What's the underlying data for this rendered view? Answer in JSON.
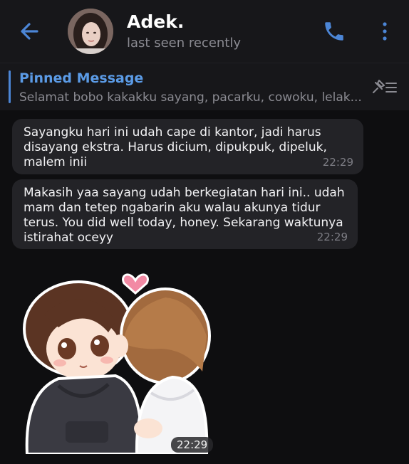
{
  "header": {
    "title": "Adek.",
    "status": "last seen recently",
    "back_icon": "arrow-left-icon",
    "call_icon": "phone-icon",
    "menu_icon": "more-vertical-icon",
    "accent": "#4c86d6"
  },
  "pinned": {
    "label": "Pinned Message",
    "text": "Selamat bobo kakakku sayang, pacarku, cowoku, lelak...",
    "unpin_icon": "unpin-icon"
  },
  "messages": [
    {
      "text": "Sayangku hari ini udah cape di kantor, jadi harus disayang ekstra. Harus dicium, dipukpuk, dipeluk, malem inii",
      "time": "22:29"
    },
    {
      "text": "Makasih yaa sayang udah berkegiatan hari ini.. udah mam dan tetep ngabarin aku walau akunya tidur terus. You did well today, honey. Sekarang waktunya istirahat oceyy",
      "time": "22:29"
    }
  ],
  "sticker": {
    "icon": "hug-sticker",
    "time": "22:29"
  }
}
